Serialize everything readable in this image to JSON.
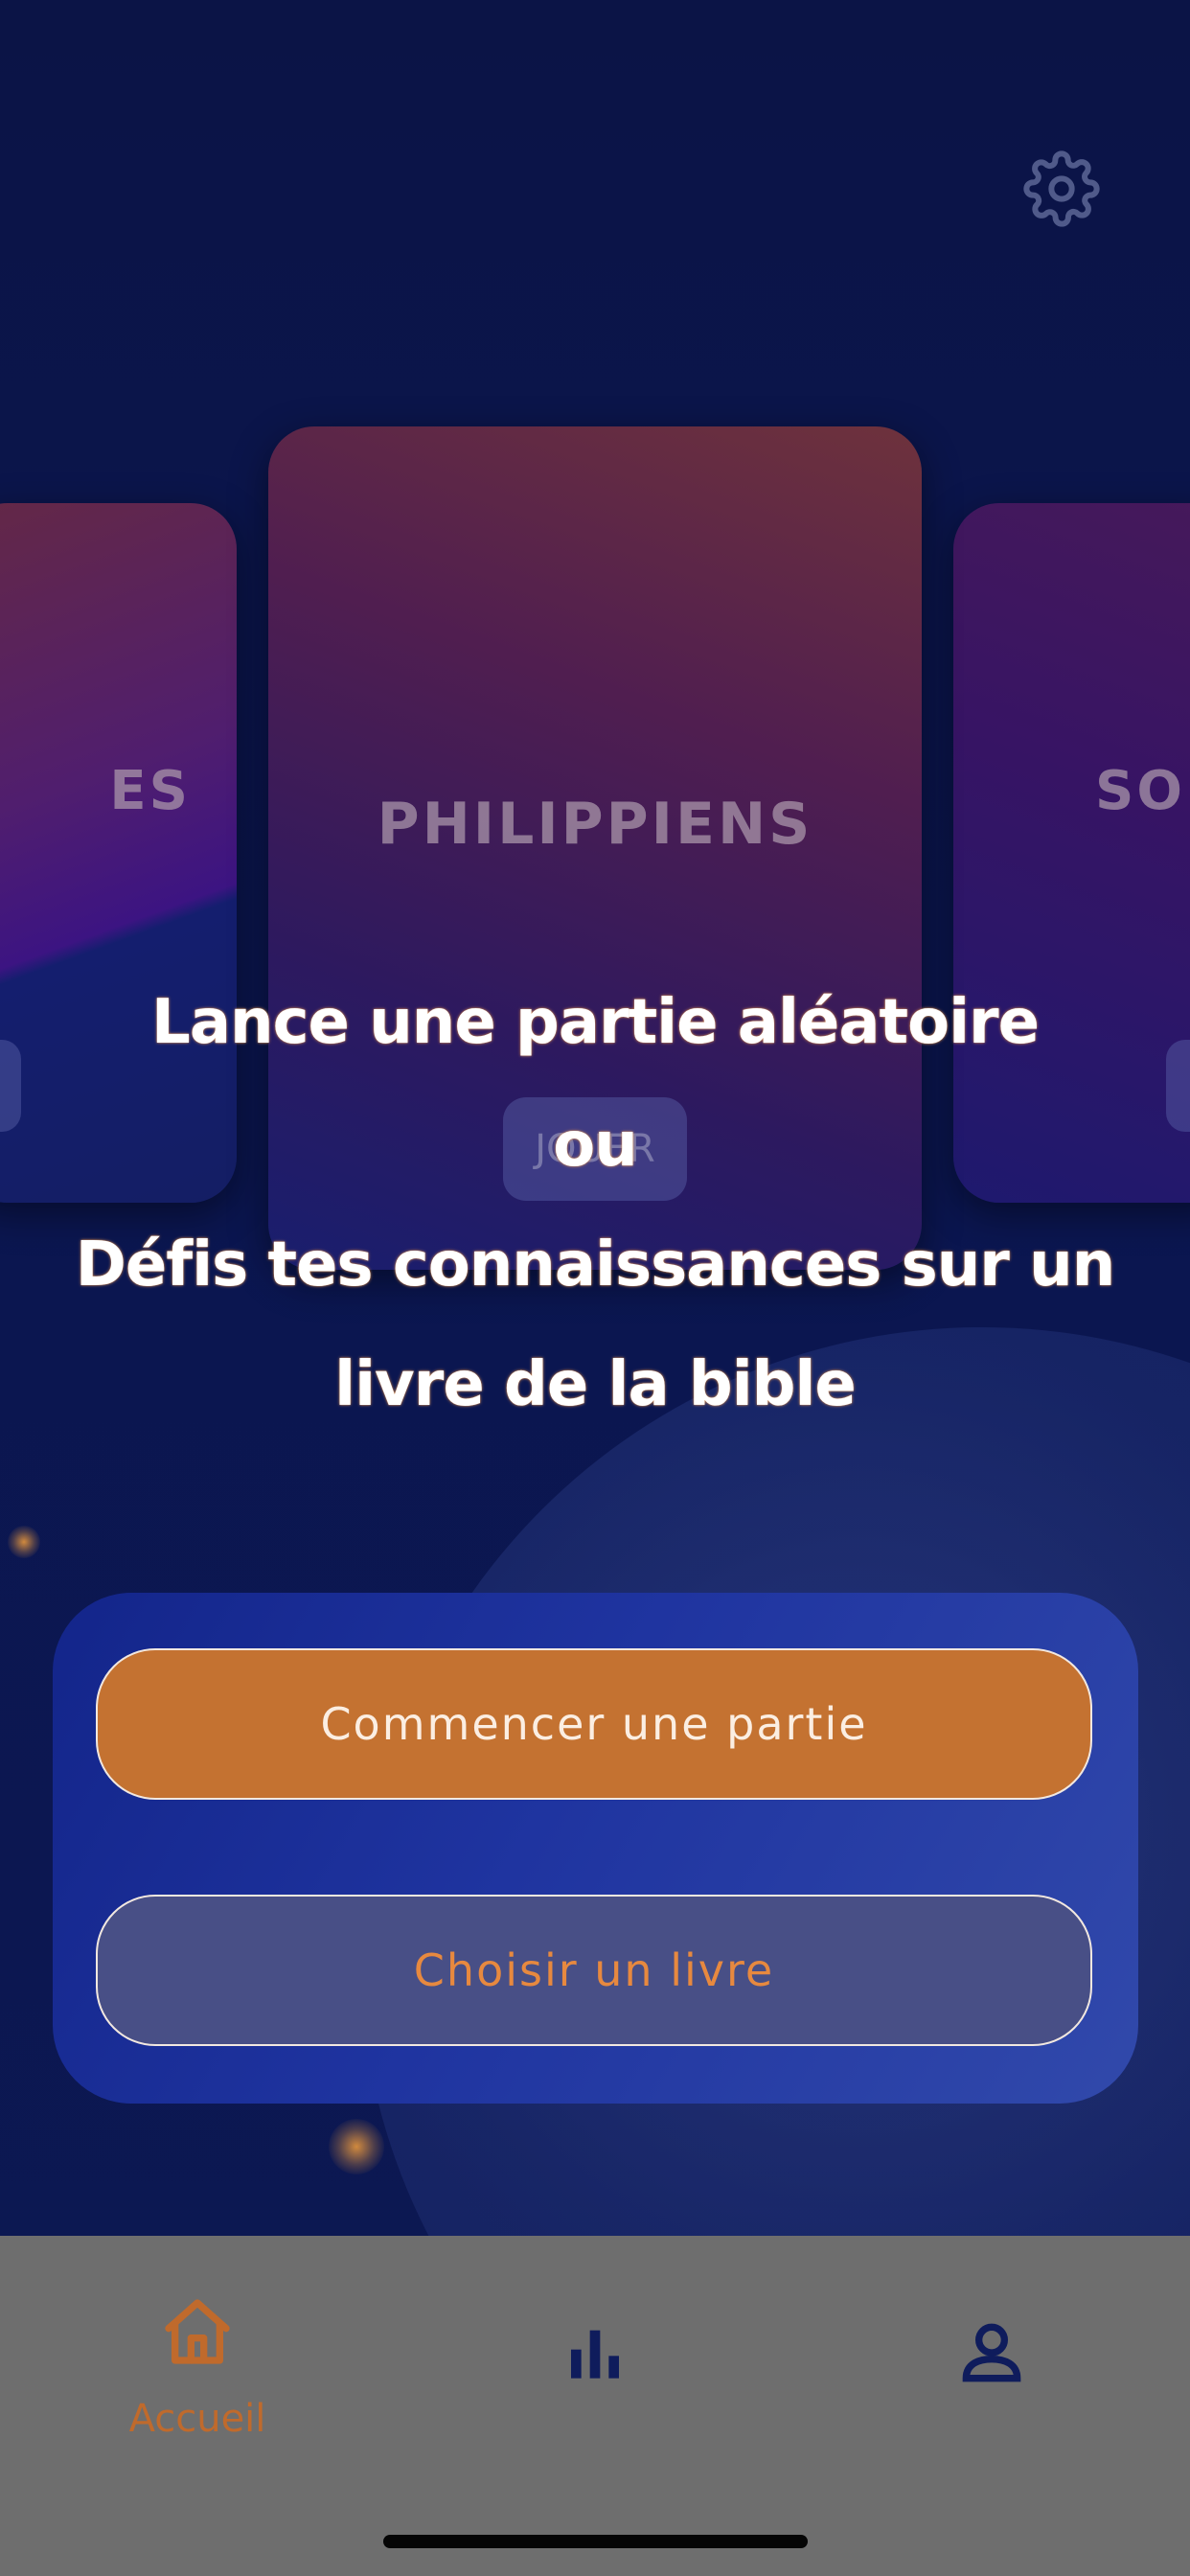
{
  "header": {
    "settings_icon": "gear-icon"
  },
  "carousel": {
    "cards": [
      {
        "title": "ES",
        "position": "left"
      },
      {
        "title": "PHILIPPIENS",
        "position": "center",
        "pill_label": "JOUER"
      },
      {
        "title": "SOP",
        "position": "right"
      }
    ]
  },
  "headline": {
    "line1": "Lance une partie aléatoire",
    "line2": "ou",
    "line3": "Défis tes connaissances sur un",
    "line4": "livre de la bible"
  },
  "actions": {
    "start_label": "Commencer une partie",
    "choose_label": "Choisir un livre"
  },
  "tabbar": {
    "items": [
      {
        "label": "Accueil",
        "icon": "home-icon",
        "active": true
      },
      {
        "label": "",
        "icon": "stats-icon",
        "active": false
      },
      {
        "label": "",
        "icon": "profile-icon",
        "active": false
      }
    ]
  },
  "colors": {
    "background": "#0b1446",
    "accent_orange": "#c47231",
    "panel_blue": "#1f34a0",
    "tabbar_gray": "#6e6e6e",
    "tab_inactive": "#0f1c5c"
  }
}
